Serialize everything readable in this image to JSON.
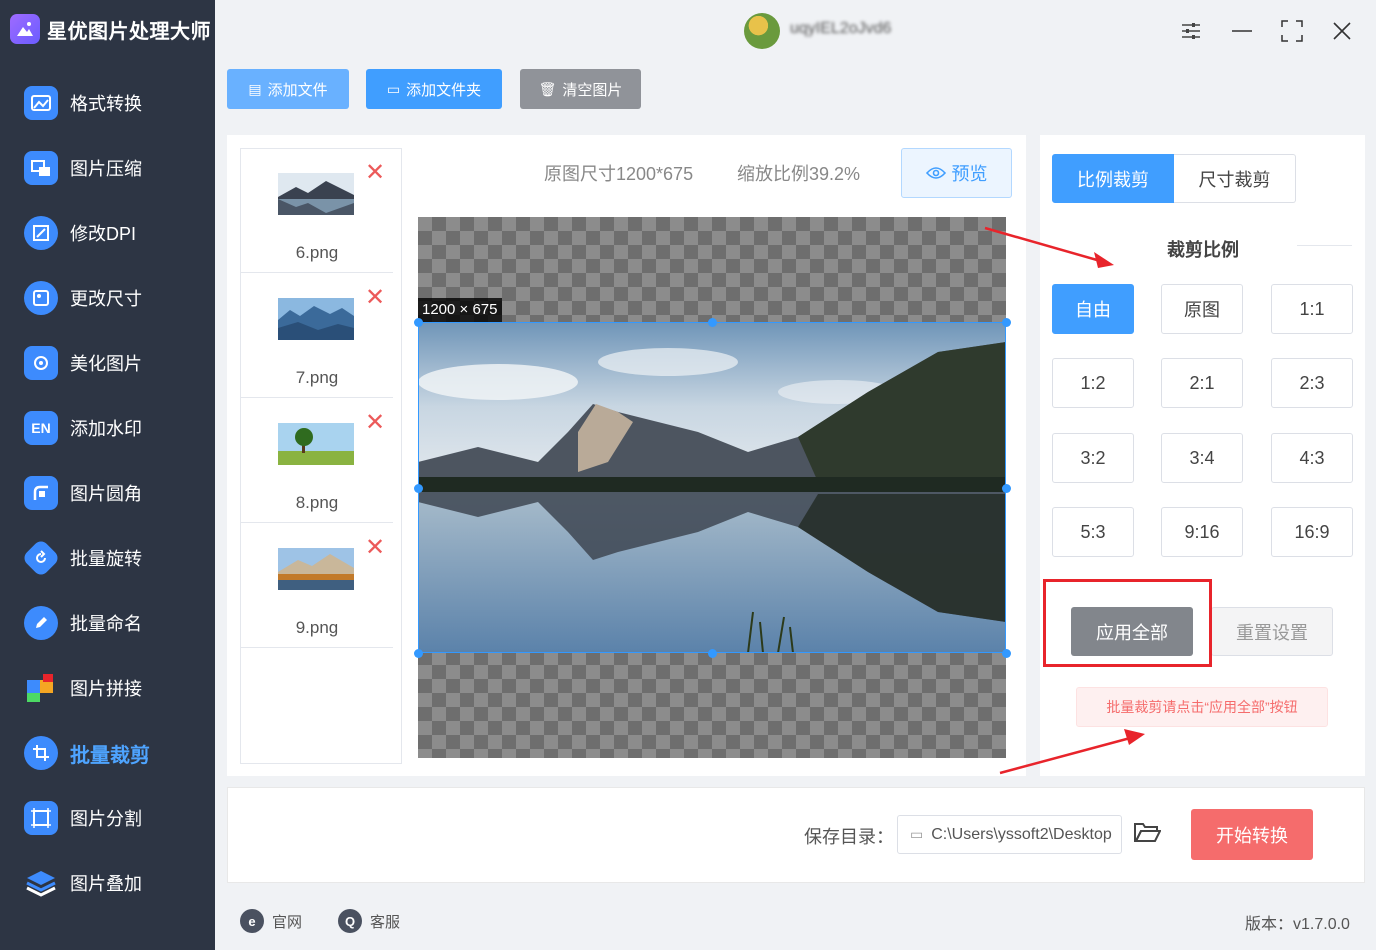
{
  "app": {
    "title": "星优图片处理大师",
    "user": "uqyIEL2oJvd6"
  },
  "sidebar": {
    "items": [
      {
        "label": "格式转换",
        "icon": "image-convert-icon",
        "color": "#3d8bfd"
      },
      {
        "label": "图片压缩",
        "icon": "compress-icon",
        "color": "#3d8bfd"
      },
      {
        "label": "修改DPI",
        "icon": "dpi-icon",
        "color": "#3d8bfd"
      },
      {
        "label": "更改尺寸",
        "icon": "resize-icon",
        "color": "#3d8bfd"
      },
      {
        "label": "美化图片",
        "icon": "beautify-icon",
        "color": "#3d8bfd"
      },
      {
        "label": "添加水印",
        "icon": "watermark-icon",
        "color": "#3d8bfd"
      },
      {
        "label": "图片圆角",
        "icon": "rounded-corner-icon",
        "color": "#3d8bfd"
      },
      {
        "label": "批量旋转",
        "icon": "rotate-icon",
        "color": "#3d8bfd"
      },
      {
        "label": "批量命名",
        "icon": "rename-icon",
        "color": "#3d8bfd"
      },
      {
        "label": "图片拼接",
        "icon": "puzzle-icon",
        "color": "#f5a623"
      },
      {
        "label": "批量裁剪",
        "icon": "crop-icon",
        "color": "#3d8bfd",
        "active": true
      },
      {
        "label": "图片分割",
        "icon": "split-icon",
        "color": "#3d8bfd"
      },
      {
        "label": "图片叠加",
        "icon": "layers-icon",
        "color": "#3d8bfd"
      }
    ]
  },
  "toolbar": {
    "add_file": "添加文件",
    "add_folder": "添加文件夹",
    "clear": "清空图片"
  },
  "files": [
    {
      "name": "6.png"
    },
    {
      "name": "7.png"
    },
    {
      "name": "8.png"
    },
    {
      "name": "9.png"
    }
  ],
  "preview": {
    "original_size": "原图尺寸1200*675",
    "scale": "缩放比例39.2%",
    "preview_button": "预览",
    "crop_dimensions": "1200 × 675"
  },
  "crop_panel": {
    "tabs": [
      "比例裁剪",
      "尺寸裁剪"
    ],
    "active_tab": "比例裁剪",
    "section_title": "裁剪比例",
    "ratios": [
      "自由",
      "原图",
      "1:1",
      "1:2",
      "2:1",
      "2:3",
      "3:2",
      "3:4",
      "4:3",
      "5:3",
      "9:16",
      "16:9"
    ],
    "selected_ratio": "自由",
    "apply_all": "应用全部",
    "reset": "重置设置",
    "hint": "批量裁剪请点击“应用全部”按钮"
  },
  "output": {
    "save_label": "保存目录：",
    "save_path": "C:\\Users\\yssoft2\\Desktop",
    "start_button": "开始转换"
  },
  "footer": {
    "website": "官网",
    "service": "客服",
    "version": "版本：v1.7.0.0"
  },
  "colors": {
    "sidebar_bg": "#2d3544",
    "primary": "#409eff",
    "danger": "#f56c6c",
    "annotation_red": "#e8242b"
  }
}
